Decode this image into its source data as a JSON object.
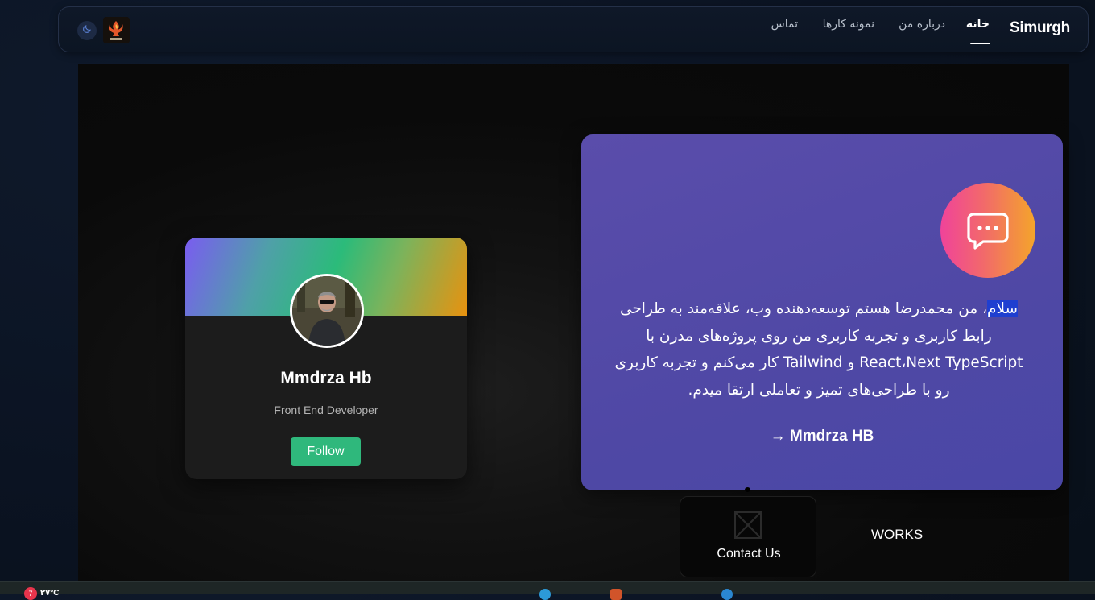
{
  "nav": {
    "brand": "Simurgh",
    "links": [
      {
        "label": "خانه",
        "active": true
      },
      {
        "label": "درباره من",
        "active": false
      },
      {
        "label": "نمونه کارها",
        "active": false
      },
      {
        "label": "تماس",
        "active": false
      }
    ],
    "theme_icon": "moon-icon",
    "logo_text": "سیمرغ"
  },
  "profile": {
    "name": "Mmdrza Hb",
    "role": "Front End Developer",
    "follow_label": "Follow"
  },
  "intro": {
    "icon": "chat-bubble-icon",
    "highlight_word": "سلام",
    "text": "، من محمدرضا هستم توسعه‌دهنده وب، علاقه‌مند به طراحی رابط کاربری و تجربه کاربری من روی پروژه‌های مدرن با React،Next TypeScript و Tailwind کار می‌کنم و تجربه کاربری رو با طراحی‌های تمیز و تعاملی ارتقا میدم.",
    "link_label": "→ Mmdrza HB"
  },
  "contact": {
    "label": "Contact Us",
    "image_icon": "broken-image-icon"
  },
  "works": {
    "label": "WORKS"
  },
  "taskbar": {
    "badge": "7",
    "text": "۲۷°C"
  },
  "colors": {
    "intro_card": "#5149a8",
    "follow": "#2fb87c",
    "highlight": "#1f3fd0"
  }
}
